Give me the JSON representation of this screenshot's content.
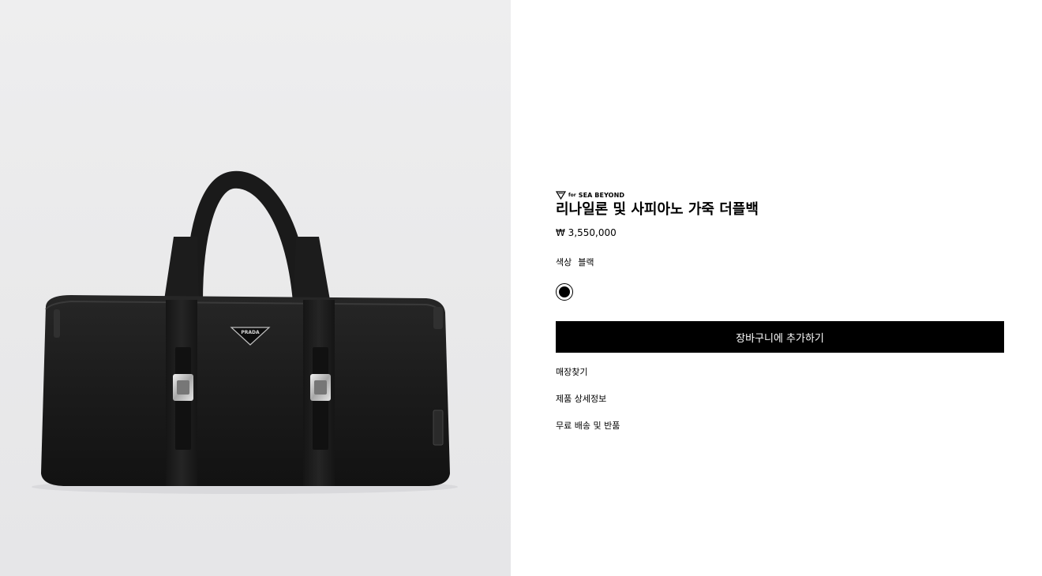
{
  "product": {
    "badge": {
      "prefix": "for",
      "text": "SEA BEYOND",
      "icon": "diamond-icon"
    },
    "title": "리나일론 및 사피아노 가죽 더플백",
    "price": "₩ 3,550,000",
    "color_label": "색상",
    "color_value": "블랙",
    "swatch_color": "#000000"
  },
  "actions": {
    "add_to_cart": "장바구니에 추가하기",
    "find_store": "매장찾기",
    "product_details": "제품 상세정보",
    "shipping_returns": "무료 배송 및 반품"
  },
  "gallery": {
    "logo_text": "PRADA",
    "image": "black-nylon-duffel-bag"
  },
  "colors": {
    "accent": "#000000",
    "button_text": "#ffffff",
    "gallery_bg": "#eeeeef"
  }
}
